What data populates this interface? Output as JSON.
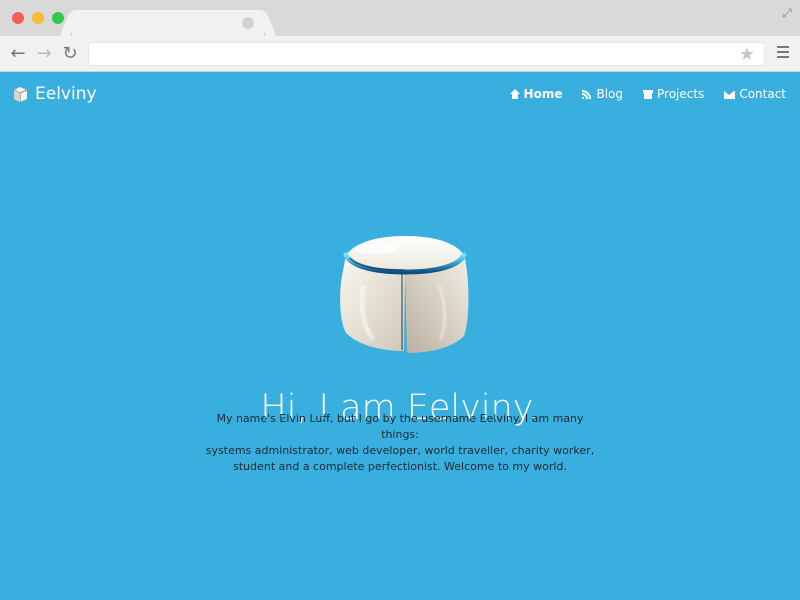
{
  "browser": {
    "address_value": "",
    "tab_title": ""
  },
  "site": {
    "brand": "Eelviny",
    "nav": [
      {
        "label": "Home",
        "icon": "home-icon",
        "active": true
      },
      {
        "label": "Blog",
        "icon": "rss-icon",
        "active": false
      },
      {
        "label": "Projects",
        "icon": "archive-icon",
        "active": false
      },
      {
        "label": "Contact",
        "icon": "envelope-icon",
        "active": false
      }
    ],
    "hero": {
      "title": "Hi, I am Eelviny.",
      "bio_lines": [
        "My name's Elvin Luff, but I go by the username Eelviny. I am many things:",
        "systems administrator, web developer, world traveller, charity worker,",
        "student and a complete perfectionist. Welcome to my world."
      ]
    },
    "colors": {
      "background": "#39afe0",
      "text": "#ffffff",
      "body_text": "#1d2933"
    }
  }
}
